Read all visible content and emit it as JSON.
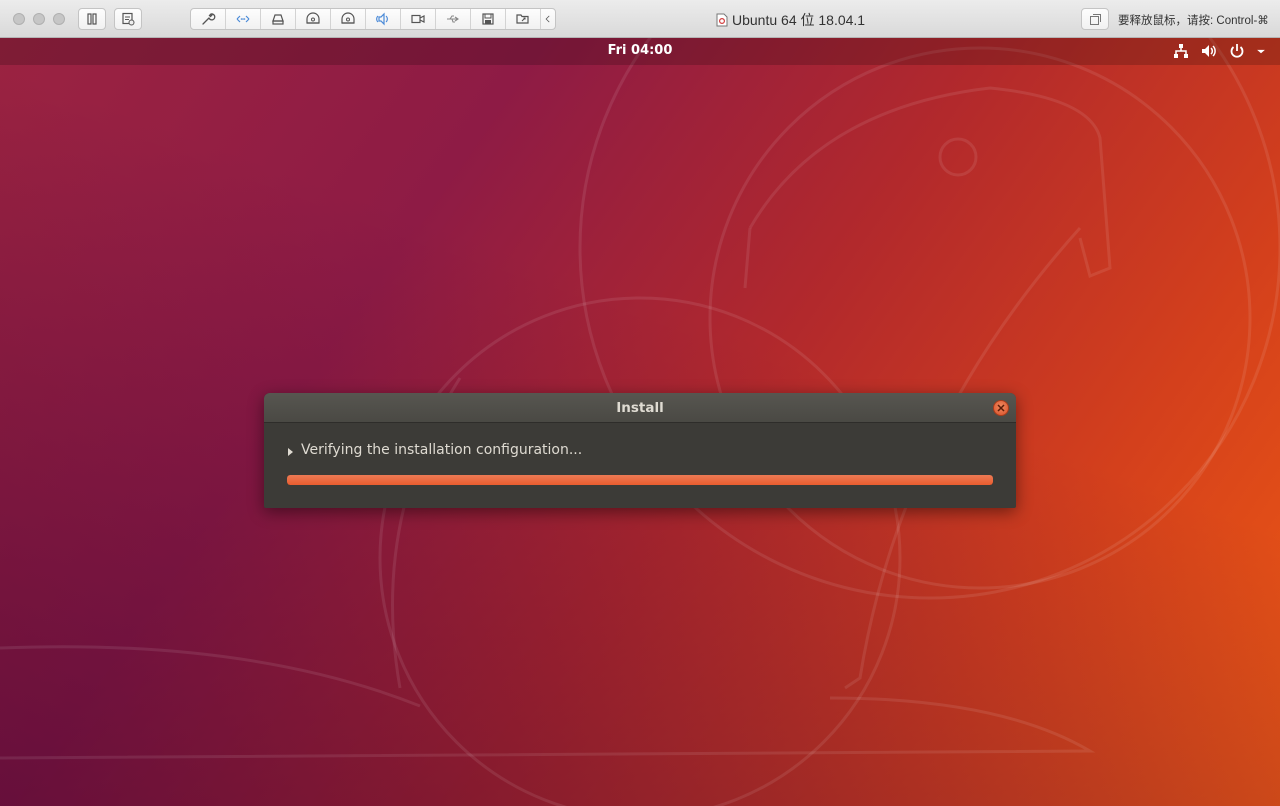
{
  "vm_window": {
    "title": "Ubuntu 64 位 18.04.1",
    "release_hint": "要释放鼠标，请按: Control-⌘",
    "toolbar_icons": [
      "pause-icon",
      "snapshot-icon",
      "settings-wrench-icon",
      "network-icon",
      "hard-disk-icon",
      "cd-dvd-icon",
      "cd-dvd-2-icon",
      "sound-icon",
      "camera-icon",
      "usb-icon",
      "floppy-icon",
      "shared-folder-icon",
      "collapse-chevron-icon",
      "fullscreen-icon"
    ]
  },
  "desktop": {
    "clock": "Fri 04:00",
    "tray_icons": [
      "network-wired-icon",
      "volume-icon",
      "power-icon",
      "chevron-down-icon"
    ]
  },
  "dialog": {
    "title": "Install",
    "status_text": "Verifying the installation configuration...",
    "progress": 1.0
  },
  "colors": {
    "accent": "#e95d2f",
    "dialog_bg": "#3c3b37",
    "wallpaper_left": "#8e1b45",
    "wallpaper_right": "#ee5a13"
  }
}
